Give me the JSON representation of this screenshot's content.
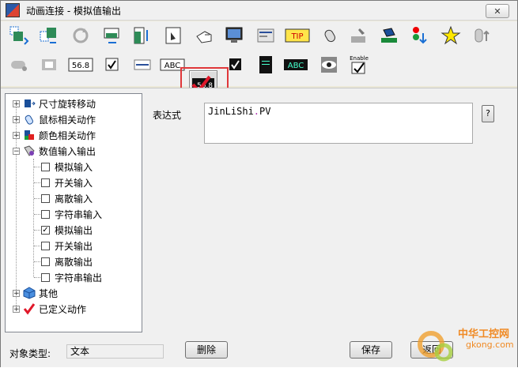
{
  "window": {
    "title": "动画连接 - 模拟值输出",
    "close_label": "✕"
  },
  "toolbar": {
    "buttons_row1": [
      {
        "name": "size-move-icon"
      },
      {
        "name": "move-icon"
      },
      {
        "name": "rotate-icon"
      },
      {
        "name": "resize-h-icon"
      },
      {
        "name": "resize-v-icon"
      },
      {
        "name": "mouse-action-icon"
      },
      {
        "name": "mouse-point-icon"
      },
      {
        "name": "monitor-icon"
      },
      {
        "name": "list-icon"
      },
      {
        "name": "tooltip-icon",
        "text": "TIP"
      },
      {
        "name": "mouse-icon"
      },
      {
        "name": "pen-icon"
      },
      {
        "name": "fill-icon"
      },
      {
        "name": "traffic-light-icon"
      },
      {
        "name": "blink-icon"
      },
      {
        "name": "hide-icon"
      }
    ],
    "buttons_row2": [
      {
        "name": "input-icon"
      },
      {
        "name": "output-icon"
      },
      {
        "name": "analog-input-icon",
        "text": "56.8"
      },
      {
        "name": "discrete-input-icon",
        "text": "✓"
      },
      {
        "name": "string-input-icon"
      },
      {
        "name": "abc-input-icon",
        "text": "ABC"
      },
      {
        "name": "analog-output-icon",
        "text": "56.8"
      },
      {
        "name": "discrete-output-icon",
        "text": "✓"
      },
      {
        "name": "dark-list-icon"
      },
      {
        "name": "abc-output-icon",
        "text": "ABC"
      },
      {
        "name": "eye-icon"
      },
      {
        "name": "enable-icon",
        "text": "Enable"
      }
    ]
  },
  "tree": {
    "nodes": [
      {
        "label": "尺寸旋转移动",
        "expander": "+"
      },
      {
        "label": "鼠标相关动作",
        "expander": "+"
      },
      {
        "label": "颜色相关动作",
        "expander": "+"
      },
      {
        "label": "数值输入输出",
        "expander": "−"
      },
      {
        "label": "模拟输入",
        "checked": ""
      },
      {
        "label": "开关输入",
        "checked": ""
      },
      {
        "label": "离散输入",
        "checked": ""
      },
      {
        "label": "字符串输入",
        "checked": ""
      },
      {
        "label": "模拟输出",
        "checked": "✓"
      },
      {
        "label": "开关输出",
        "checked": ""
      },
      {
        "label": "离散输出",
        "checked": ""
      },
      {
        "label": "字符串输出",
        "checked": ""
      },
      {
        "label": "其他",
        "expander": "+"
      },
      {
        "label": "已定义动作",
        "expander": "+"
      }
    ]
  },
  "expression": {
    "label": "表达式",
    "value_prefix": "JinLiShi",
    "value_dot": ".",
    "value_suffix": "PV",
    "help_label": "?"
  },
  "bottom": {
    "object_type_label": "对象类型:",
    "object_type_value": "文本",
    "delete_label": "删除",
    "save_label": "保存",
    "return_label": "返回"
  },
  "watermark": {
    "line1": "中华工控网",
    "line2": "gkong.com"
  }
}
